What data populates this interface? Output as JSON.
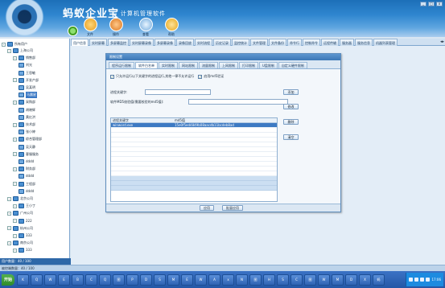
{
  "app": {
    "brand": "蚂蚁企业宝",
    "subtitle": "计算机管理软件"
  },
  "toolbar": [
    {
      "label": "文件",
      "icon": "folder-icon",
      "color": "#f3b33b"
    },
    {
      "label": "操作",
      "icon": "gears-icon",
      "color": "#e78b3a"
    },
    {
      "label": "查看",
      "icon": "magnifier-icon",
      "color": "#7fb8e8"
    },
    {
      "label": "帮助",
      "icon": "help-icon",
      "color": "#f0b335"
    }
  ],
  "window_controls": [
    "_",
    "□",
    "x"
  ],
  "tabs": [
    "用户信息",
    "实时屏幕",
    "多屏幕监控",
    "实时屏幕录像",
    "多屏幕录像",
    "录像回放",
    "实时流程",
    "历史记录",
    "监控统计",
    "文件管理",
    "文件备份",
    "命令行",
    "控制命令",
    "远程传输",
    "服务器",
    "服务信息",
    "机器列表管理"
  ],
  "tree": {
    "root": "所有用户",
    "items": [
      {
        "label": "上海公司",
        "level": 1
      },
      {
        "label": "销售部",
        "level": 2
      },
      {
        "label": "刘光",
        "level": 3
      },
      {
        "label": "王思敏",
        "level": 3
      },
      {
        "label": "开发产部",
        "level": 2
      },
      {
        "label": "吴某明",
        "level": 3
      },
      {
        "label": "马晨星",
        "level": 3,
        "selected": true
      },
      {
        "label": "采购部",
        "level": 2
      },
      {
        "label": "胡晓辉",
        "level": 3
      },
      {
        "label": "黄红洪",
        "level": 3
      },
      {
        "label": "技术部",
        "level": 2
      },
      {
        "label": "张小婷",
        "level": 3
      },
      {
        "label": "综合管理部",
        "level": 2
      },
      {
        "label": "吴天静",
        "level": 3
      },
      {
        "label": "客服服务",
        "level": 2
      },
      {
        "label": "dddd",
        "level": 3
      },
      {
        "label": "财务部",
        "level": 2
      },
      {
        "label": "dddd",
        "level": 3
      },
      {
        "label": "工程部",
        "level": 2
      },
      {
        "label": "dddd",
        "level": 3
      },
      {
        "label": "北京公司",
        "level": 1
      },
      {
        "label": "王小丁",
        "level": 2
      },
      {
        "label": "广州公司",
        "level": 1
      },
      {
        "label": "222",
        "level": 2
      },
      {
        "label": "杭州公司",
        "level": 1
      },
      {
        "label": "333",
        "level": 2
      },
      {
        "label": "南京公司",
        "level": 1
      },
      {
        "label": "333",
        "level": 2
      }
    ]
  },
  "user_count": "用户数量：40 / 100",
  "dialog": {
    "title": "限制设置",
    "tabs": [
      "程序运行限制",
      "软件白名单",
      "实时限制",
      "网站限制",
      "流量限制",
      "上网限制",
      "打印限制",
      "U盘限制",
      "自定义硬件限制"
    ],
    "active_tab": 1,
    "checkbox1_label": "只允许运行以下关键字的进程运行,其他一律不允许运行",
    "checkbox2_label": "启用md5验证",
    "keyword_label": "进程关键字:",
    "keyword_value": "",
    "md5_label": "软件MD5校验值(需要校验的md5值):",
    "md5_value": "",
    "buttons": {
      "add": "添加",
      "edit": "修改",
      "delete": "删除",
      "clear": "清空"
    },
    "table": {
      "columns": [
        "进程关键字",
        "md5值"
      ],
      "rows": [
        [
          "winword.exe",
          "15e0f5ed4849b08aacdb11bcdeb8ad"
        ]
      ]
    },
    "footer": {
      "apply": "应用",
      "apply_all": "批量应用"
    }
  },
  "statusbar": "被控端数量：40 / 100",
  "taskbar": {
    "start": "开始",
    "buttons": [
      "K",
      "Q",
      "W",
      "E",
      "B",
      "C",
      "Q",
      "图",
      "P",
      "D",
      "S",
      "M",
      "E",
      "W",
      "A",
      "x",
      "N",
      "图",
      "H",
      "S",
      "C",
      "图",
      "W",
      "M",
      "D",
      "X",
      "蚂"
    ],
    "clock": "17:06"
  }
}
